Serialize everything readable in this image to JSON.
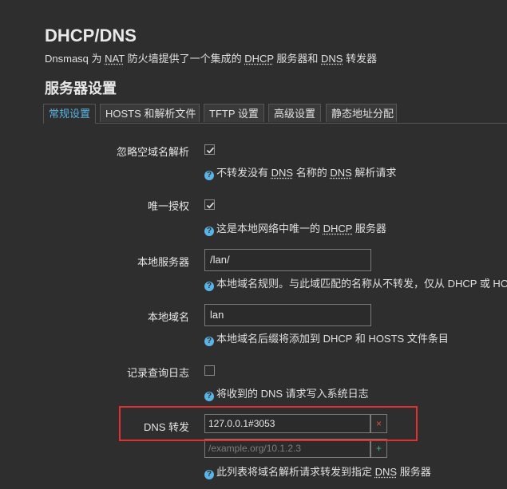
{
  "header": {
    "title": "DHCP/DNS",
    "description_parts": [
      "Dnsmasq 为 ",
      "NAT",
      " 防火墙提供了一个集成的 ",
      "DHCP",
      " 服务器和 ",
      "DNS",
      " 转发器"
    ],
    "section_title": "服务器设置"
  },
  "tabs": [
    {
      "label": "常规设置",
      "active": true
    },
    {
      "label": "HOSTS 和解析文件",
      "active": false
    },
    {
      "label": "TFTP 设置",
      "active": false
    },
    {
      "label": "高级设置",
      "active": false
    },
    {
      "label": "静态地址分配",
      "active": false
    }
  ],
  "fields": {
    "domain_needed": {
      "label": "忽略空域名解析",
      "checked": true,
      "help_parts": [
        "不转发没有 ",
        "DNS",
        " 名称的 ",
        "DNS",
        " 解析请求"
      ]
    },
    "authoritative": {
      "label": "唯一授权",
      "checked": true,
      "help_parts": [
        "这是本地网络中唯一的 ",
        "DHCP",
        " 服务器"
      ]
    },
    "local_server": {
      "label": "本地服务器",
      "value": "/lan/",
      "help": "本地域名规则。与此域匹配的名称从不转发，仅从 DHCP 或 HOSTS"
    },
    "local_domain": {
      "label": "本地域名",
      "value": "lan",
      "help": "本地域名后缀将添加到 DHCP 和 HOSTS 文件条目"
    },
    "log_queries": {
      "label": "记录查询日志",
      "checked": false,
      "help": "将收到的 DNS 请求写入系统日志"
    },
    "dns_forward": {
      "label": "DNS 转发",
      "value": "127.0.0.1#3053",
      "remove_symbol": "×",
      "placeholder": "/example.org/10.1.2.3",
      "add_symbol": "+",
      "help_parts": [
        "此列表将域名解析请求转发到指定 ",
        "DNS",
        " 服务器"
      ]
    }
  },
  "icons": {
    "help": "question-circle-icon",
    "check": "checkmark-icon"
  },
  "colors": {
    "background": "#2e2e2e",
    "accent": "#5ab4e5",
    "remove": "#e24b4b",
    "add": "#47b38a",
    "highlight": "#e03030"
  }
}
